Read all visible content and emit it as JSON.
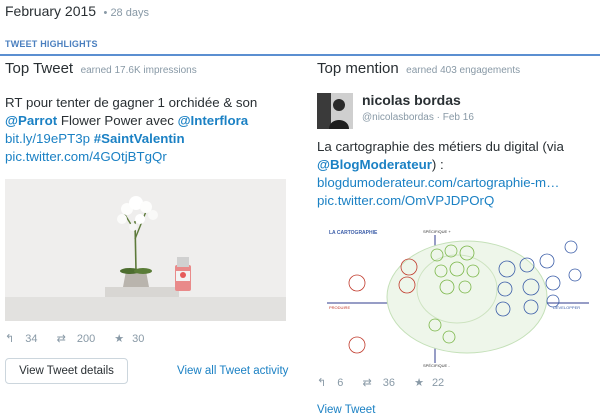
{
  "header": {
    "month": "February 2015",
    "days": "28 days"
  },
  "section": {
    "label": "TWEET HIGHLIGHTS"
  },
  "top_tweet": {
    "title": "Top Tweet",
    "subtitle": "earned 17.6K impressions",
    "text_part1": "RT pour tenter de gagner 1 orchidée & son ",
    "mention": "@Parrot",
    "text_part2": " Flower Power avec ",
    "mention2": "@Interflora",
    "link1": "bit.ly/19ePT3p",
    "hashtag": "#SaintValentin",
    "link2": "pic.twitter.com/4GOtjBTgQr",
    "stats": {
      "replies": "34",
      "retweets": "200",
      "favorites": "30"
    },
    "button_label": "View Tweet details",
    "activity_link": "View all Tweet activity"
  },
  "top_mention": {
    "title": "Top mention",
    "subtitle": "earned 403 engagements",
    "author_name": "nicolas bordas",
    "author_handle": "@nicolasbordas",
    "date": "Feb 16",
    "text_part1": "La cartographie des métiers du digital (via ",
    "mention": "@BlogModerateur",
    "text_part2": ") :",
    "link1": "blogdumoderateur.com/cartographie-m…",
    "link2": "pic.twitter.com/OmVPJDPOrQ",
    "stats": {
      "replies": "6",
      "retweets": "36",
      "favorites": "22"
    },
    "view_link": "View Tweet",
    "infographic": {
      "title": "LA CARTOGRAPHIE",
      "top_axis": "SPÉCIFIQUE +",
      "bottom_axis": "SPÉCIFIQUE -",
      "left_label": "PRODUIRE",
      "right_label": "DÉVELOPPER"
    }
  },
  "colors": {
    "link": "#1b81c4",
    "accent_rule": "#5b8fd1",
    "muted": "#8899a6"
  }
}
